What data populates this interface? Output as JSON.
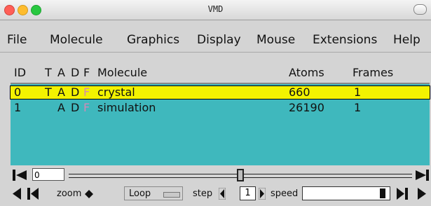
{
  "window": {
    "title": "VMD"
  },
  "menu": [
    "File",
    "Molecule",
    "Graphics",
    "Display",
    "Mouse",
    "Extensions",
    "Help"
  ],
  "columns": {
    "id": "ID",
    "t": "T",
    "a": "A",
    "d": "D",
    "f": "F",
    "molecule": "Molecule",
    "atoms": "Atoms",
    "frames": "Frames"
  },
  "molecules": [
    {
      "id": "0",
      "t": "T",
      "a": "A",
      "d": "D",
      "f": "F",
      "name": "crystal",
      "atoms": "660",
      "frames": "1",
      "selected": true
    },
    {
      "id": "1",
      "t": "",
      "a": "A",
      "d": "D",
      "f": "F",
      "name": "simulation",
      "atoms": "26190",
      "frames": "1",
      "selected": false
    }
  ],
  "controls": {
    "frame_value": "0",
    "zoom_label": "zoom",
    "loop_label": "Loop",
    "step_label": "step",
    "step_value": "1",
    "speed_label": "speed",
    "slider_fraction": 0.5
  },
  "colors": {
    "selected_row": "#f3f300",
    "list_background": "#3fb8bd",
    "flag_faint": "#d28ab7"
  }
}
